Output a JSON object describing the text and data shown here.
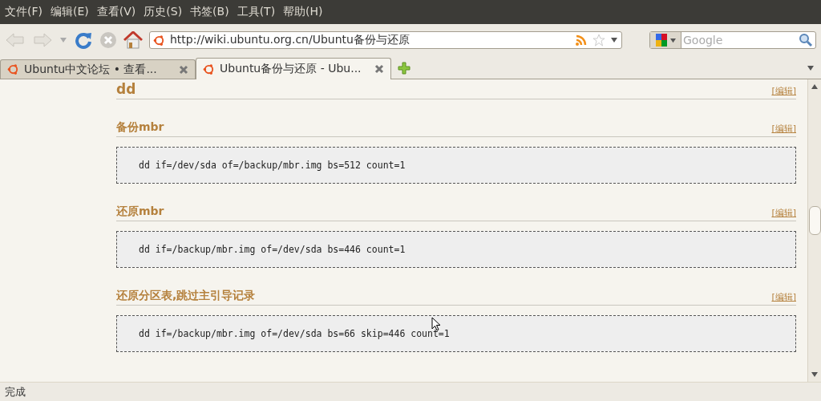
{
  "menu": [
    "文件(F)",
    "编辑(E)",
    "查看(V)",
    "历史(S)",
    "书签(B)",
    "工具(T)",
    "帮助(H)"
  ],
  "toolbar": {
    "url": "http://wiki.ubuntu.org.cn/Ubuntu备份与还原",
    "search": {
      "placeholder": "Google"
    }
  },
  "tabs": [
    {
      "label": "Ubuntu中文论坛 • 查看...",
      "selected": false
    },
    {
      "label": "Ubuntu备份与还原 - Ubu...",
      "selected": true
    }
  ],
  "sections": [
    {
      "heading": "dd",
      "edit": "[编辑]",
      "kind": "title"
    },
    {
      "heading": "备份mbr",
      "edit": "[编辑]",
      "kind": "section",
      "code": "dd if=/dev/sda of=/backup/mbr.img bs=512 count=1"
    },
    {
      "heading": "还原mbr",
      "edit": "[编辑]",
      "kind": "section",
      "code": "dd if=/backup/mbr.img of=/dev/sda bs=446 count=1"
    },
    {
      "heading": "还原分区表,跳过主引导记录",
      "edit": "[编辑]",
      "kind": "section",
      "code": "dd if=/backup/mbr.img of=/dev/sda bs=66 skip=446 count=1"
    }
  ],
  "status_bar": "完成"
}
